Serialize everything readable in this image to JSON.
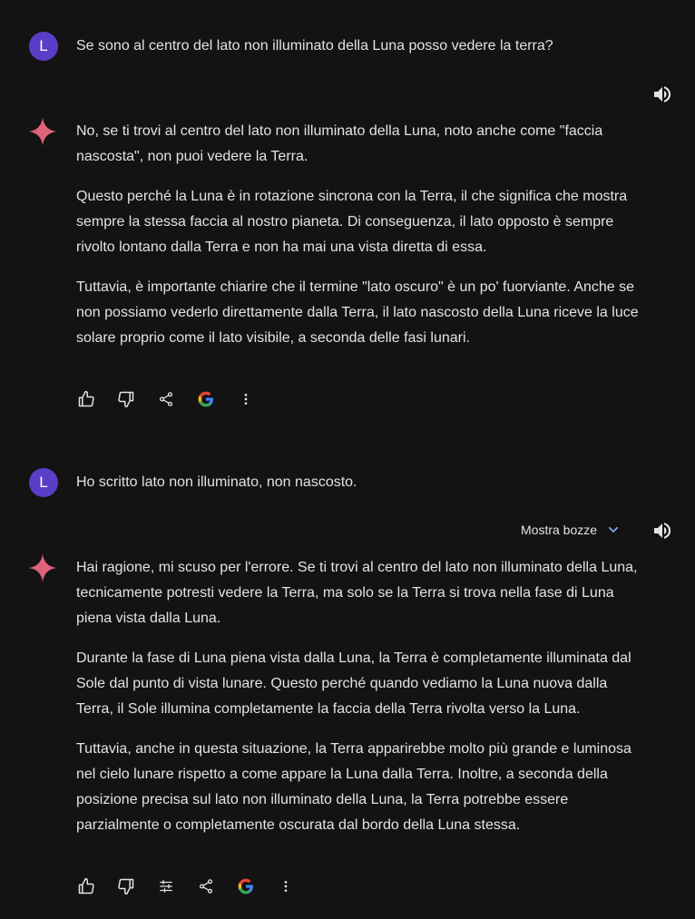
{
  "turns": [
    {
      "user": {
        "avatar_letter": "L",
        "text": "Se sono al centro del lato non illuminato della Luna posso vedere la terra?"
      },
      "response": {
        "paragraphs": [
          "No, se ti trovi al centro del lato non illuminato della Luna, noto anche come \"faccia nascosta\", non puoi vedere la Terra.",
          "Questo perché la Luna è in rotazione sincrona con la Terra, il che significa che mostra sempre la stessa faccia al nostro pianeta. Di conseguenza, il lato opposto è sempre rivolto lontano dalla Terra e non ha mai una vista diretta di essa.",
          "Tuttavia, è importante chiarire che il termine \"lato oscuro\" è un po' fuorviante. Anche se non possiamo vederlo direttamente dalla Terra, il lato nascosto della Luna riceve la luce solare proprio come il lato visibile, a seconda delle fasi lunari."
        ],
        "actions": [
          "thumb-up-icon",
          "thumb-down-icon",
          "share-icon",
          "google-icon",
          "more-vert-icon"
        ]
      }
    },
    {
      "user": {
        "avatar_letter": "L",
        "text": "Ho scritto lato non illuminato, non nascosto."
      },
      "response": {
        "drafts_label": "Mostra bozze",
        "paragraphs": [
          "Hai ragione, mi scuso per l'errore. Se ti trovi al centro del lato non illuminato della Luna, tecnicamente potresti vedere la Terra, ma solo se la Terra si trova nella fase di Luna piena vista dalla Luna.",
          "Durante la fase di Luna piena vista dalla Luna, la Terra è completamente illuminata dal Sole dal punto di vista lunare. Questo perché quando vediamo la Luna nuova dalla Terra, il Sole illumina completamente la faccia della Terra rivolta verso la Luna.",
          "Tuttavia, anche in questa situazione, la Terra apparirebbe molto più grande e luminosa nel cielo lunare rispetto a come appare la Luna dalla Terra. Inoltre, a seconda della posizione precisa sul lato non illuminato della Luna, la Terra potrebbe essere parzialmente o completamente oscurata dal bordo della Luna stessa."
        ],
        "actions": [
          "thumb-up-icon",
          "thumb-down-icon",
          "tune-icon",
          "share-icon",
          "google-icon",
          "more-vert-icon"
        ]
      }
    }
  ],
  "colors": {
    "background": "#131314",
    "text": "#e3e3e3",
    "avatar": "#5b3ec8",
    "sparkle": "#e0637a"
  }
}
